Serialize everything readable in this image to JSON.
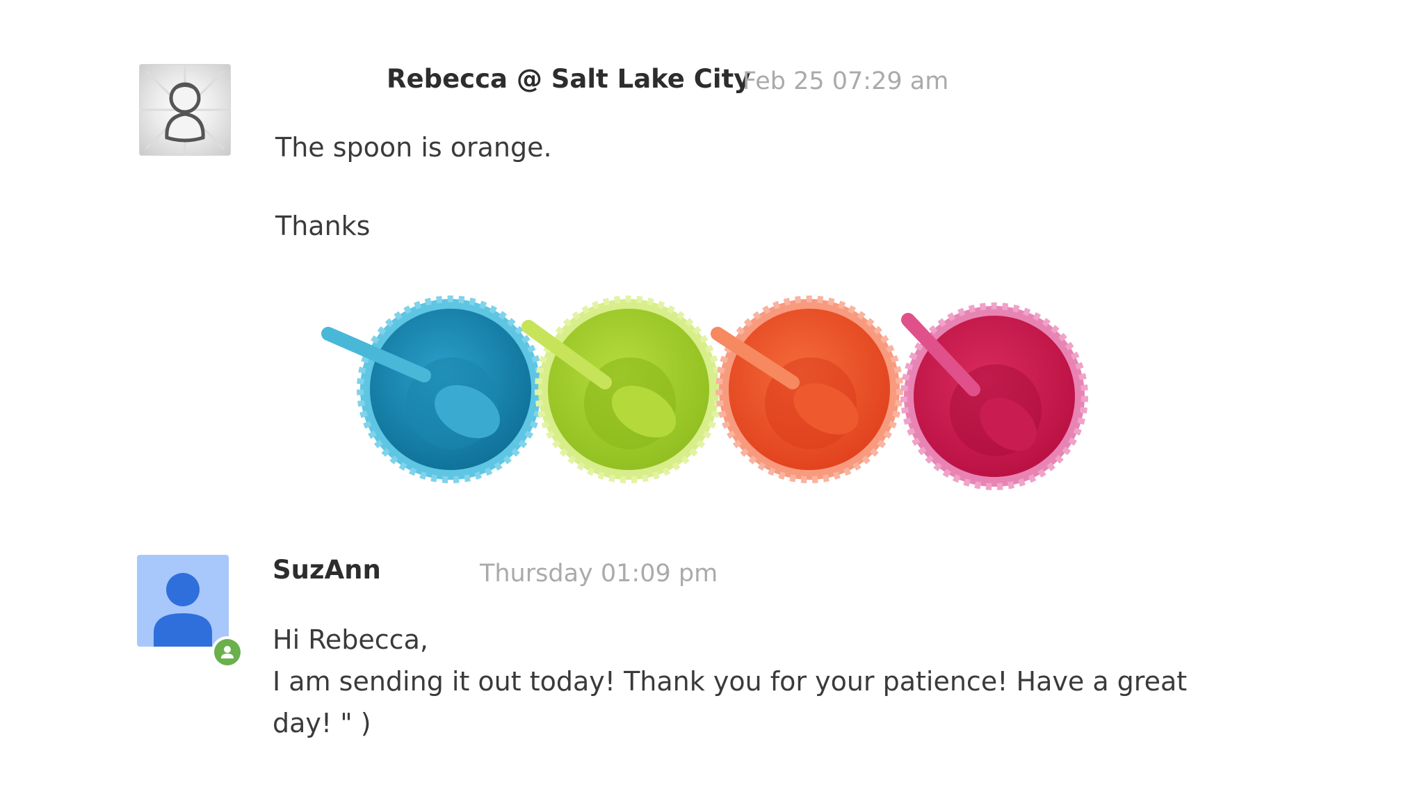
{
  "messages": [
    {
      "author": "Rebecca @ Salt Lake City",
      "time": "Feb 25 07:29 am",
      "lines": [
        "The spoon is orange.",
        "Thanks"
      ],
      "avatar": "default-user-avatar-icon",
      "attachment": {
        "type": "image",
        "content": "four-bowls-with-spoons",
        "colors": [
          "#1e8fb8",
          "#a3cf2e",
          "#ef5a2e",
          "#d11c52"
        ]
      }
    },
    {
      "author": "SuzAnn",
      "time": "Thursday 01:09 pm",
      "lines": [
        "Hi Rebecca,",
        "I am sending it out today! Thank you for your patience! Have a great",
        "day! \" )"
      ],
      "avatar": "agent-avatar-icon",
      "badge": "online-status-icon"
    }
  ]
}
